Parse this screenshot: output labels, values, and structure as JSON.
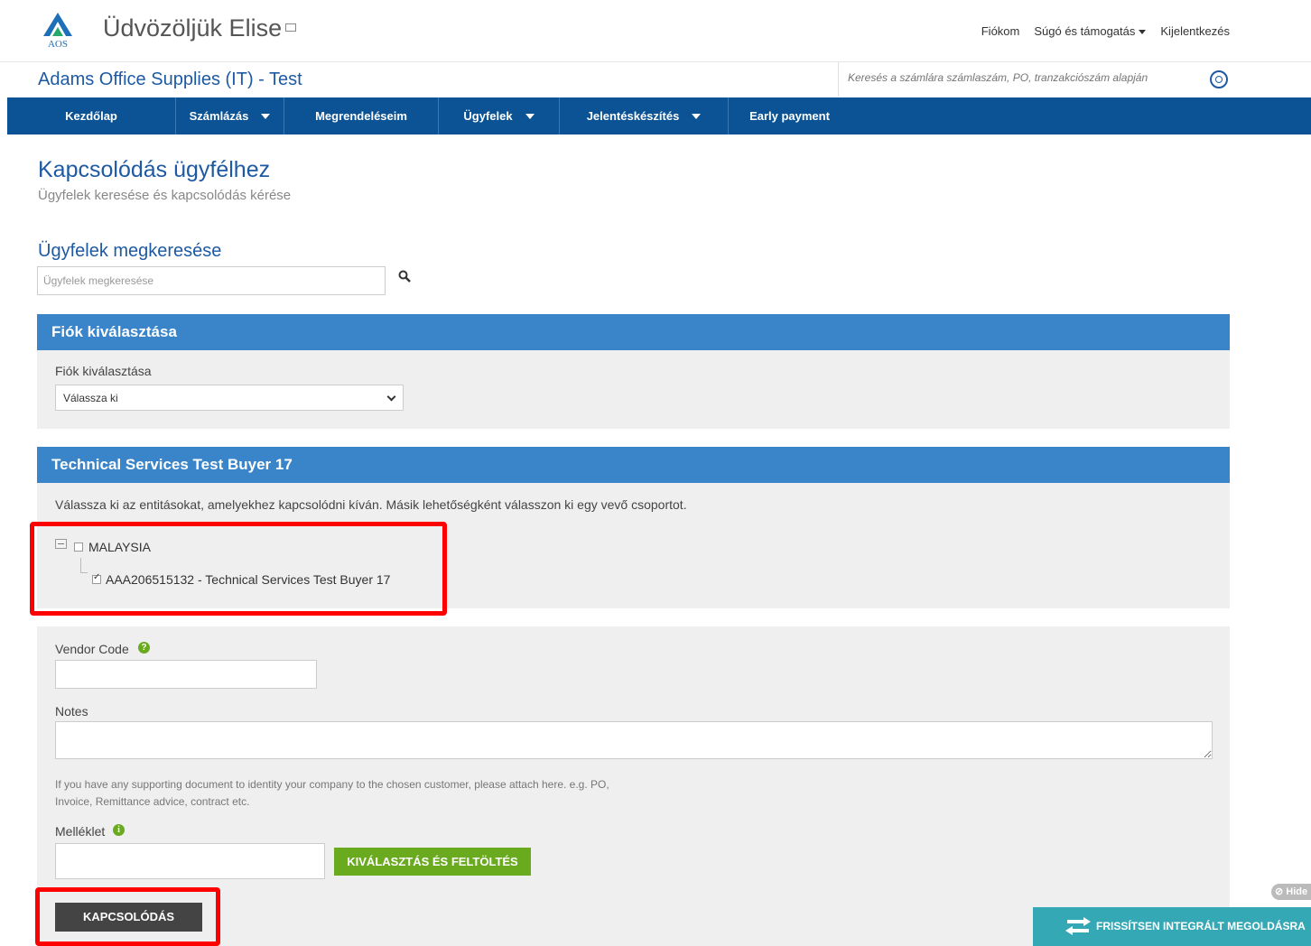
{
  "header": {
    "logo_text": "AOS",
    "welcome": "Üdvözöljük Elise",
    "links": {
      "account": "Fiókom",
      "help": "Súgó és támogatás",
      "logout": "Kijelentkezés"
    },
    "company": "Adams Office Supplies (IT) - Test",
    "search_placeholder": "Keresés a számlára számlaszám, PO, tranzakciószám alapján"
  },
  "nav": {
    "items": [
      {
        "label": "Kezdőlap"
      },
      {
        "label": "Számlázás"
      },
      {
        "label": "Megrendeléseim"
      },
      {
        "label": "Ügyfelek"
      },
      {
        "label": "Jelentéskészítés"
      },
      {
        "label": "Early payment"
      }
    ]
  },
  "page": {
    "title": "Kapcsolódás ügyfélhez",
    "subtitle": "Ügyfelek keresése és kapcsolódás kérése",
    "search_heading": "Ügyfelek megkeresése",
    "search_placeholder": "Ügyfelek megkeresése"
  },
  "account_panel": {
    "heading": "Fiók kiválasztása",
    "label": "Fiók kiválasztása",
    "selected": "Válassza ki"
  },
  "entity_panel": {
    "heading": "Technical Services Test Buyer 17",
    "instruction": "Válassza ki az entitásokat, amelyekhez kapcsolódni kíván. Másik lehetőségként válasszon ki egy vevő csoportot.",
    "tree": {
      "group": {
        "label": "MALAYSIA",
        "checked": false
      },
      "child": {
        "label": "AAA206515132 - Technical Services Test Buyer 17",
        "checked": true
      }
    }
  },
  "form": {
    "vendor_code_label": "Vendor Code",
    "vendor_code_value": "",
    "notes_label": "Notes",
    "notes_value": "",
    "support_text_line1": "If you have any supporting document to identity your company to the chosen customer, please attach here. e.g. PO,",
    "support_text_line2": "Invoice, Remittance advice, contract etc.",
    "attachment_label": "Melléklet",
    "upload_button": "KIVÁLASZTÁS ÉS FELTÖLTÉS",
    "connect_button": "KAPCSOLÓDÁS"
  },
  "footer_widgets": {
    "hide_label": "Hide",
    "upgrade_banner": "FRISSÍTSEN INTEGRÁLT MEGOLDÁSRA"
  },
  "colors": {
    "brand_blue": "#0b5394",
    "panel_blue": "#3a85c9",
    "accent_green": "#6aaa1e",
    "highlight_red": "#ff0000",
    "banner_teal": "#35a8b5"
  }
}
